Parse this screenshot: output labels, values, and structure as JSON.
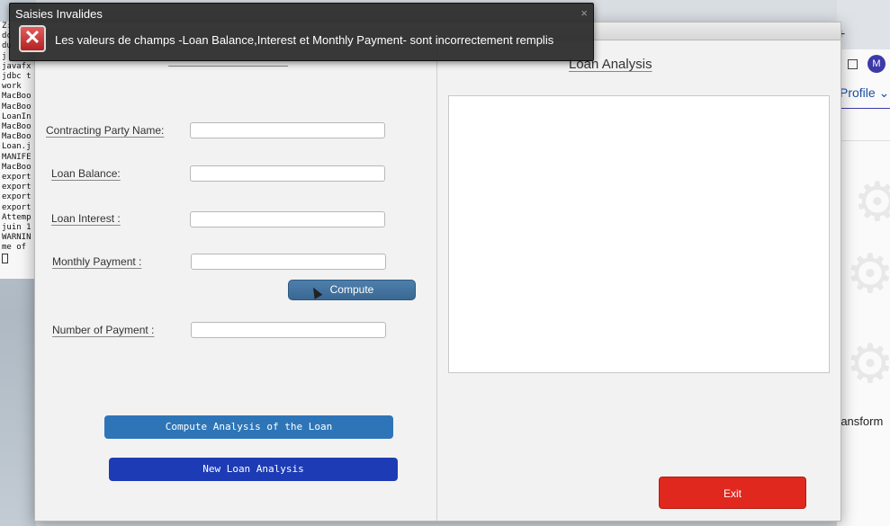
{
  "terminal_lines": [
    "Z:",
    "dc",
    "du",
    "j",
    "javafx",
    "jdbc t",
    "work",
    "MacBoo",
    "MacBoo",
    "LoanIn",
    "MacBoo",
    "MacBoo",
    "Loan.j",
    "MANIFE",
    "MacBoo",
    "export",
    "export",
    "export",
    "export",
    "Attemp",
    "juin 1",
    "WARNIN",
    "me of"
  ],
  "background": {
    "profile_label": "Profile",
    "avatar_letter": "M",
    "side_text": "ransform",
    "plus": "+"
  },
  "notification": {
    "title": "Saisies Invalides",
    "message": "Les valeurs de champs -Loan Balance,Interest et Monthly Payment- sont incorrectement remplis",
    "close_symbol": "×",
    "error_symbol": "✕"
  },
  "form": {
    "contracting_party_label": "Contracting Party Name:",
    "loan_balance_label": "Loan Balance:",
    "loan_interest_label": "Loan Interest :",
    "monthly_payment_label": "Monthly Payment :",
    "number_of_payment_label": "Number of Payment :",
    "contracting_party_value": "",
    "loan_balance_value": "",
    "loan_interest_value": "",
    "monthly_payment_value": "",
    "number_of_payment_value": "",
    "compute_label": "Compute",
    "compute_analysis_label": "Compute  Analysis of the Loan",
    "new_analysis_label": "New Loan Analysis"
  },
  "analysis": {
    "title": "Loan Analysis",
    "exit_label": "Exit"
  },
  "colors": {
    "compute_button": "#3a6893",
    "analysis_button": "#2e75b8",
    "new_button": "#1d3bb5",
    "exit_button": "#e0281e"
  }
}
